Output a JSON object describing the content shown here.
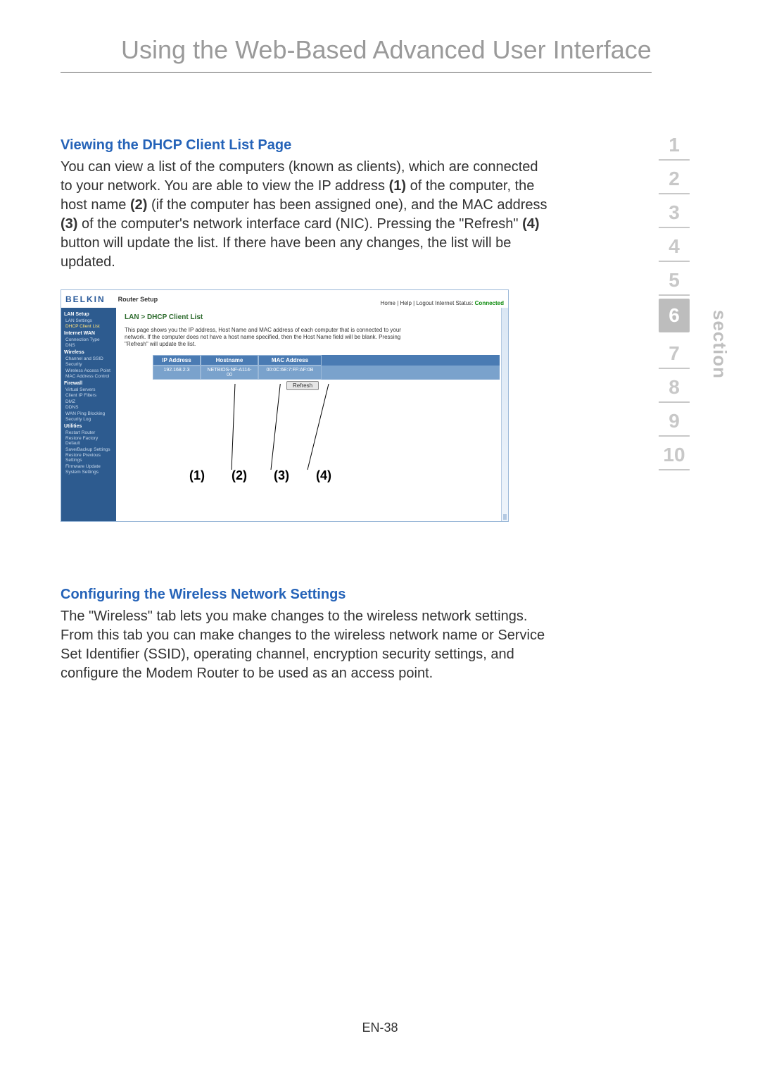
{
  "page_title": "Using the Web-Based Advanced User Interface",
  "section_nav": [
    "1",
    "2",
    "3",
    "4",
    "5",
    "6",
    "7",
    "8",
    "9",
    "10"
  ],
  "active_section_index": 5,
  "section_label": "section",
  "page_number": "EN-38",
  "block1": {
    "heading": "Viewing the DHCP Client List Page",
    "p1a": "You can view a list of the computers (known as clients), which are connected to your network. You are able to view the IP address ",
    "p1b": "(1)",
    "p1c": " of the computer, the host name ",
    "p1d": "(2)",
    "p1e": " (if the computer has been assigned one), and the MAC address ",
    "p1f": "(3)",
    "p1g": " of the computer's network interface card (NIC). Pressing the \"Refresh\" ",
    "p1h": "(4)",
    "p1i": " button will update the list. If there have been any changes, the list will be updated."
  },
  "screenshot": {
    "logo": "BELKIN",
    "setup": "Router Setup",
    "links": "Home | Help | Logout   Internet Status:",
    "status": "Connected",
    "sidebar": {
      "groups": [
        {
          "head": "LAN Setup",
          "items": [
            {
              "label": "LAN Settings"
            },
            {
              "label": "DHCP Client List",
              "active": true
            }
          ]
        },
        {
          "head": "Internet WAN",
          "items": [
            {
              "label": "Connection Type"
            },
            {
              "label": "DNS"
            }
          ]
        },
        {
          "head": "Wireless",
          "items": [
            {
              "label": "Channel and SSID"
            },
            {
              "label": "Security"
            },
            {
              "label": "Wireless Access Point"
            },
            {
              "label": "MAC Address Control"
            }
          ]
        },
        {
          "head": "Firewall",
          "items": [
            {
              "label": "Virtual Servers"
            },
            {
              "label": "Client IP Filters"
            },
            {
              "label": "DMZ"
            },
            {
              "label": "DDNS"
            },
            {
              "label": "WAN Ping Blocking"
            },
            {
              "label": "Security Log"
            }
          ]
        },
        {
          "head": "Utilities",
          "items": [
            {
              "label": "Restart Router"
            },
            {
              "label": "Restore Factory Default"
            },
            {
              "label": "Save/Backup Settings"
            },
            {
              "label": "Restore Previous Settings"
            },
            {
              "label": "Firmware Update"
            },
            {
              "label": "System Settings"
            }
          ]
        }
      ]
    },
    "breadcrumb": "LAN > DHCP Client List",
    "desc": "This page shows you the IP address, Host Name and MAC address of each computer that is connected to your network. If the computer does not have a host name specified, then the Host Name field will be blank. Pressing \"Refresh\" will update the list.",
    "table": {
      "headers": {
        "ip": "IP Address",
        "host": "Hostname",
        "mac": "MAC Address"
      },
      "row": {
        "ip": "192.168.2.3",
        "host": "NETBIOS-NF-A114-00",
        "mac": "00:0C:6E:7:FF:AF:0B"
      }
    },
    "refresh": "Refresh",
    "callouts": [
      "(1)",
      "(2)",
      "(3)",
      "(4)"
    ]
  },
  "block2": {
    "heading": "Configuring the Wireless Network Settings",
    "para": "The \"Wireless\" tab lets you make changes to the wireless network settings. From this tab you can make changes to the wireless network name or Service Set Identifier (SSID), operating channel, encryption security settings, and configure the Modem Router to be used as an access point."
  }
}
